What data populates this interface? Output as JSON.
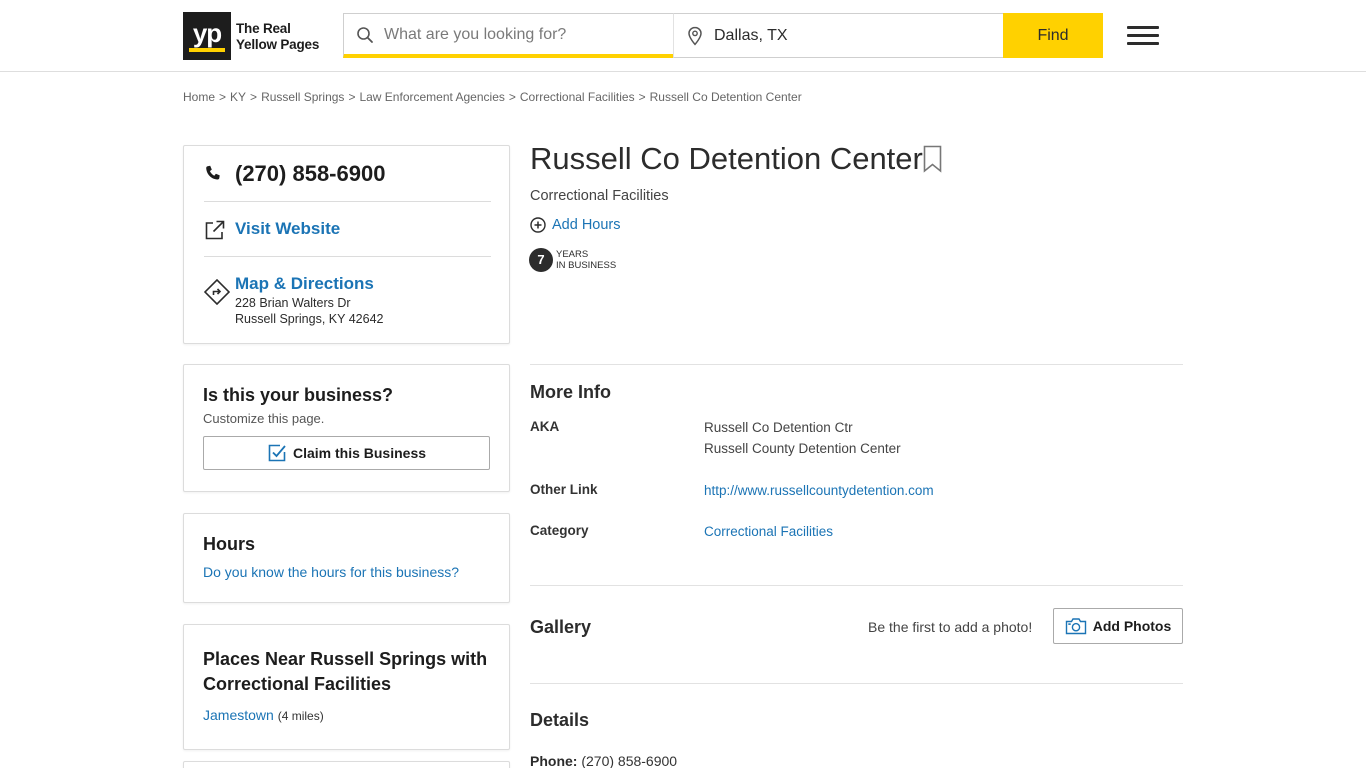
{
  "header": {
    "logo_mark": "yp",
    "logo_line1": "The Real",
    "logo_line2": "Yellow Pages",
    "search_placeholder": "What are you looking for?",
    "location_value": "Dallas, TX",
    "find_label": "Find"
  },
  "breadcrumb": [
    "Home",
    "KY",
    "Russell Springs",
    "Law Enforcement Agencies",
    "Correctional Facilities",
    "Russell Co Detention Center"
  ],
  "contact": {
    "phone": "(270) 858-6900",
    "website_label": "Visit Website",
    "map_label": "Map & Directions",
    "address_line1": "228 Brian Walters Dr",
    "address_line2": "Russell Springs, KY 42642"
  },
  "claim": {
    "title": "Is this your business?",
    "subtitle": "Customize this page.",
    "button_label": "Claim this Business"
  },
  "hours": {
    "title": "Hours",
    "prompt": "Do you know the hours for this business?"
  },
  "places": {
    "title": "Places Near Russell Springs with Correctional Facilities",
    "items": [
      {
        "name": "Jamestown",
        "distance": "(4 miles)"
      }
    ]
  },
  "business": {
    "name": "Russell Co Detention Center",
    "category": "Correctional Facilities",
    "add_hours_label": "Add Hours",
    "years_number": "7",
    "years_line1": "YEARS",
    "years_line2": "IN BUSINESS"
  },
  "more_info": {
    "title": "More Info",
    "aka_label": "AKA",
    "aka_values": [
      "Russell Co Detention Ctr",
      "Russell County Detention Center"
    ],
    "other_link_label": "Other Link",
    "other_link_value": "http://www.russellcountydetention.com",
    "category_label": "Category",
    "category_value": "Correctional Facilities"
  },
  "gallery": {
    "title": "Gallery",
    "note": "Be the first to add a photo!",
    "button_label": "Add Photos"
  },
  "details": {
    "title": "Details",
    "phone_label": "Phone:",
    "phone_value": "(270) 858-6900"
  },
  "colors": {
    "brand_yellow": "#ffd100",
    "link_blue": "#1b74b5",
    "text_dark": "#2c2c2c"
  }
}
